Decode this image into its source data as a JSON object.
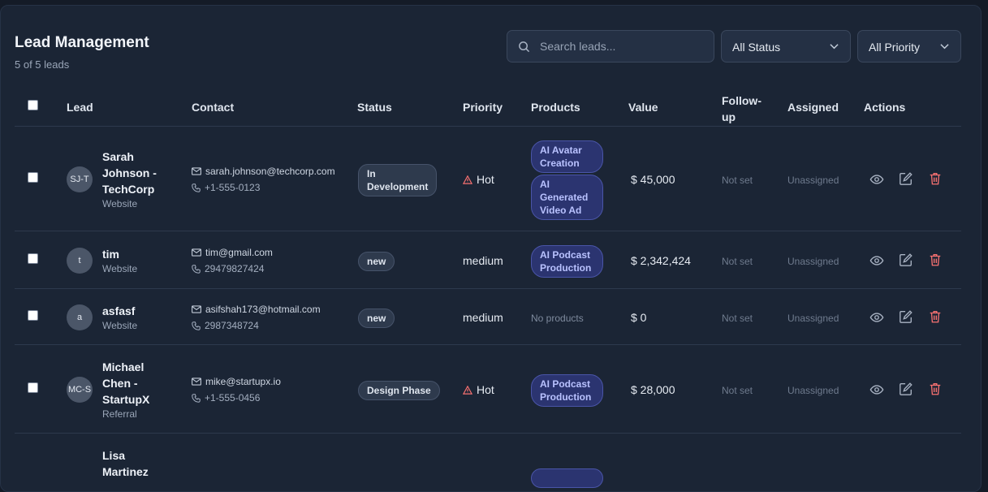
{
  "header": {
    "title": "Lead Management",
    "subtitle": "5 of 5 leads"
  },
  "search": {
    "placeholder": "Search leads..."
  },
  "filters": {
    "status": "All Status",
    "priority": "All Priority"
  },
  "columns": [
    "Lead",
    "Contact",
    "Status",
    "Priority",
    "Products",
    "Value",
    "Follow-up",
    "Assigned",
    "Actions"
  ],
  "rows": [
    {
      "initials": "SJ-T",
      "name": "Sarah Johnson - TechCorp",
      "source": "Website",
      "email": "sarah.johnson@techcorp.com",
      "phone": "+1-555-0123",
      "status": "In Development",
      "priority": "Hot",
      "products": [
        "AI Avatar Creation",
        "AI Generated Video Ad"
      ],
      "value": "$45,000",
      "followup": "Not set",
      "assigned": "Unassigned"
    },
    {
      "initials": "t",
      "name": "tim",
      "source": "Website",
      "email": "tim@gmail.com",
      "phone": "29479827424",
      "status": "new",
      "priority": "medium",
      "products": [
        "AI Podcast Production"
      ],
      "value": "$2,342,424",
      "followup": "Not set",
      "assigned": "Unassigned"
    },
    {
      "initials": "a",
      "name": "asfasf",
      "source": "Website",
      "email": "asifshah173@hotmail.com",
      "phone": "2987348724",
      "status": "new",
      "priority": "medium",
      "products_empty": "No products",
      "value": "$0",
      "followup": "Not set",
      "assigned": "Unassigned"
    },
    {
      "initials": "MC-S",
      "name": "Michael Chen - StartupX",
      "source": "Referral",
      "email": "mike@startupx.io",
      "phone": "+1-555-0456",
      "status": "Design Phase",
      "priority": "Hot",
      "products": [
        "AI Podcast Production"
      ],
      "value": "$28,000",
      "followup": "Not set",
      "assigned": "Unassigned"
    },
    {
      "name": "Lisa Martinez"
    }
  ],
  "currency_symbol": "$",
  "colors": {
    "background": "#141b27",
    "card": "#1b2535",
    "product_badge": "#2b3470",
    "hot": "#f87171",
    "delete": "#f87171"
  }
}
